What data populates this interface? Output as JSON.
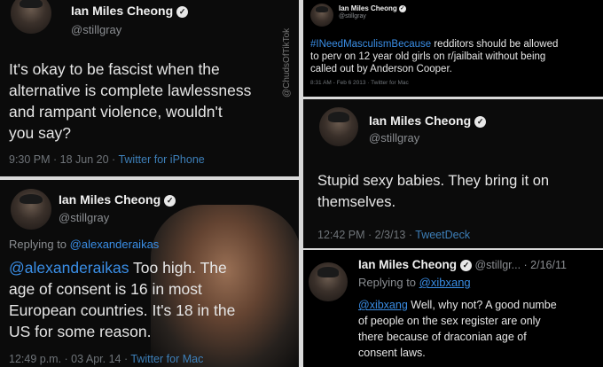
{
  "panels": {
    "p1": {
      "name": "Ian Miles Cheong",
      "handle": "@stillgray",
      "body_lines": [
        "It's okay to be fascist when the",
        "alternative is complete lawlessness",
        "and rampant violence, wouldn't",
        "you say?"
      ],
      "meta_time": "9:30 PM · 18 Jun 20 · ",
      "meta_source": "Twitter for iPhone",
      "watermark": "@ChudsOfTikTok"
    },
    "p2": {
      "name": "Ian Miles Cheong",
      "handle": "@stillgray",
      "replying_prefix": "Replying to ",
      "replying_to": "@alexanderaikas",
      "mention": "@alexanderaikas",
      "body_first_rest": " Too high. The",
      "body_lines": [
        "age of consent is 16 in most",
        "European countries. It's 18 in the",
        "US for some reason."
      ],
      "meta_time": "12:49 p.m. · 03 Apr. 14 · ",
      "meta_source": "Twitter for Mac"
    },
    "p3": {
      "name": "Ian Miles Cheong",
      "handle": "@stillgray",
      "hashtag": "#INeedMasculismBecause",
      "line1_rest": " redditors should be allowed",
      "body_lines": [
        "to perv on 12 year old girls on r/jailbait without being",
        "called out by Anderson Cooper."
      ],
      "meta": "8:31 AM - Feb 6 2013 · Twitter for Mac"
    },
    "p4": {
      "name": "Ian Miles Cheong",
      "handle": "@stillgray",
      "body_lines": [
        "Stupid sexy babies. They bring it on",
        "themselves."
      ],
      "meta_time": "12:42 PM · 2/3/13 · ",
      "meta_source": "TweetDeck"
    },
    "p5": {
      "name": "Ian Miles Cheong",
      "handle_date": " @stillgr... · 2/16/11",
      "replying_prefix": "Replying to ",
      "replying_to": "@xibxang",
      "mention": "@xibxang",
      "line1_rest": " Well, why not? A good numbe",
      "body_lines": [
        "of people on the sex register are only",
        "there because of draconian age of",
        "consent laws."
      ]
    }
  }
}
